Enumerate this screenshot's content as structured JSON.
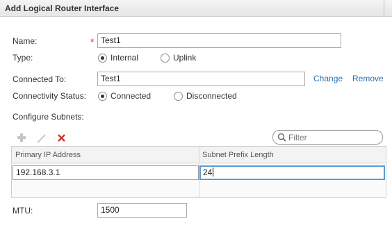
{
  "dialog": {
    "title": "Add Logical Router Interface"
  },
  "form": {
    "name_label": "Name:",
    "name_required_mark": "*",
    "name_value": "Test1",
    "type_label": "Type:",
    "type_options": [
      "Internal",
      "Uplink"
    ],
    "type_selected": "Internal",
    "connected_to_label": "Connected To:",
    "connected_to_value": "Test1",
    "change_link": "Change",
    "remove_link": "Remove",
    "connectivity_label": "Connectivity Status:",
    "connectivity_options": [
      "Connected",
      "Disconnected"
    ],
    "connectivity_selected": "Connected",
    "subnets_label": "Configure Subnets:",
    "mtu_label": "MTU:",
    "mtu_value": "1500"
  },
  "toolbar": {
    "add_icon": "plus-icon",
    "edit_icon": "pencil-icon",
    "delete_icon": "x-icon",
    "filter_placeholder": "Filter"
  },
  "subnet_table": {
    "columns": [
      "Primary IP Address",
      "Subnet Prefix Length"
    ],
    "rows": [
      [
        "192.168.3.1",
        "24"
      ]
    ]
  },
  "colors": {
    "required": "#d9342b",
    "link": "#2f6fa8",
    "focus": "#5b9bd5",
    "delete": "#d9342b"
  }
}
